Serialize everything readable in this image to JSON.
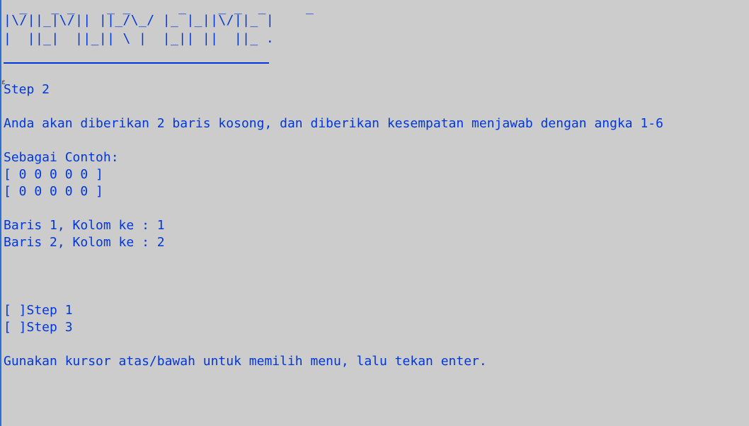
{
  "banner": {
    "row1": "  _   _ _    _ _      _    _ _  _     _",
    "row2": "|\\/||_|\\/|| ||_/\\_/ |_ |_||\\/||_ |",
    "row3": "|  ||_|  ||_|| \\ |  |_|| ||  ||_ ."
  },
  "cursor_glyph": "ε",
  "step_title": "Step 2",
  "instructions": "Anda akan diberikan 2 baris kosong, dan diberikan kesempatan menjawab dengan angka 1-6",
  "example_label": "Sebagai Contoh:",
  "example_rows": [
    "[ 0 0 0 0 0 ]",
    "[ 0 0 0 0 0 ]"
  ],
  "answers": [
    "Baris 1, Kolom ke : 1",
    "Baris 2, Kolom ke : 2"
  ],
  "menu": [
    "[ ]Step 1",
    "[ ]Step 3"
  ],
  "footer": "Gunakan kursor atas/bawah untuk memilih menu, lalu tekan enter.",
  "colors": {
    "background": "#cccccc",
    "text": "#0037da"
  }
}
